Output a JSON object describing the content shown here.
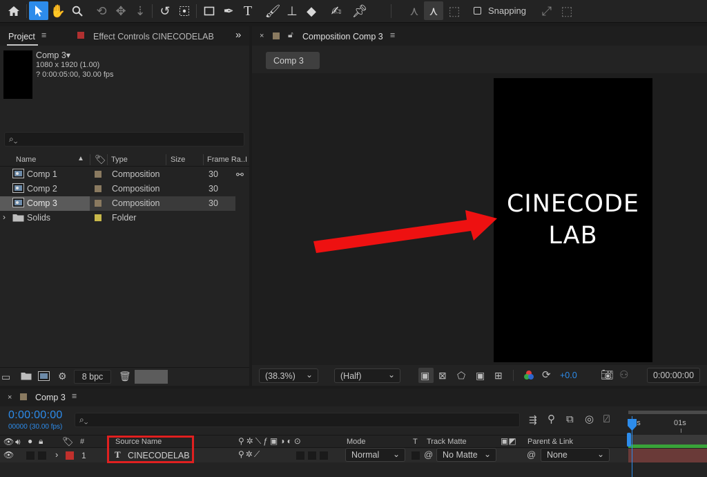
{
  "toolbar": {
    "snapping_label": "Snapping"
  },
  "project_panel": {
    "tab_label": "Project",
    "effect_controls_label": "Effect Controls CINECODELAB",
    "expand_glyph": "»",
    "comp_name": "Comp 3▾",
    "comp_size": "1080 x 1920 (1.00)",
    "comp_duration": "? 0:00:05:00, 30.00 fps",
    "search_glyph": "⌕⌄",
    "columns": {
      "name": "Name",
      "type": "Type",
      "size": "Size",
      "frame_rate": "Frame Ra...",
      "extra": "I"
    },
    "items": [
      {
        "name": "Comp 1",
        "type": "Composition",
        "frame_rate": "30",
        "color": "#8a7a60"
      },
      {
        "name": "Comp 2",
        "type": "Composition",
        "frame_rate": "30",
        "color": "#8a7a60"
      },
      {
        "name": "Comp 3",
        "type": "Composition",
        "frame_rate": "30",
        "color": "#8a7a60"
      },
      {
        "name": "Solids",
        "type": "Folder",
        "frame_rate": "",
        "color": "#c8b84a"
      }
    ],
    "bpc_label": "8 bpc"
  },
  "comp_panel": {
    "tab_label": "Composition Comp 3",
    "comp_tab": "Comp 3",
    "canvas_text_line1": "CINECODE",
    "canvas_text_line2": "LAB",
    "zoom": "(38.3%)",
    "resolution": "(Half)",
    "exposure": "+0.0",
    "timecode": "0:00:00:00"
  },
  "timeline": {
    "tab_label": "Comp 3",
    "timecode": "0:00:00:00",
    "frame_info": "00000 (30.00 fps)",
    "search_glyph": "⌕⌄",
    "columns": {
      "number": "#",
      "source_name": "Source Name",
      "mode": "Mode",
      "t": "T",
      "track_matte": "Track Matte",
      "parent": "Parent & Link"
    },
    "ruler": {
      "start": "00s",
      "one": "01s"
    },
    "layers": [
      {
        "index": "1",
        "name": "CINECODELAB",
        "type_icon": "T",
        "mode": "Normal",
        "track_matte": "No Matte",
        "parent": "None",
        "color": "#c0302c"
      }
    ]
  },
  "colors": {
    "accent": "#2d8ceb",
    "highlight_box": "#e02020",
    "arrow": "#ee1111",
    "green_bar": "#39a439",
    "layer_bar": "#6a3a38"
  }
}
